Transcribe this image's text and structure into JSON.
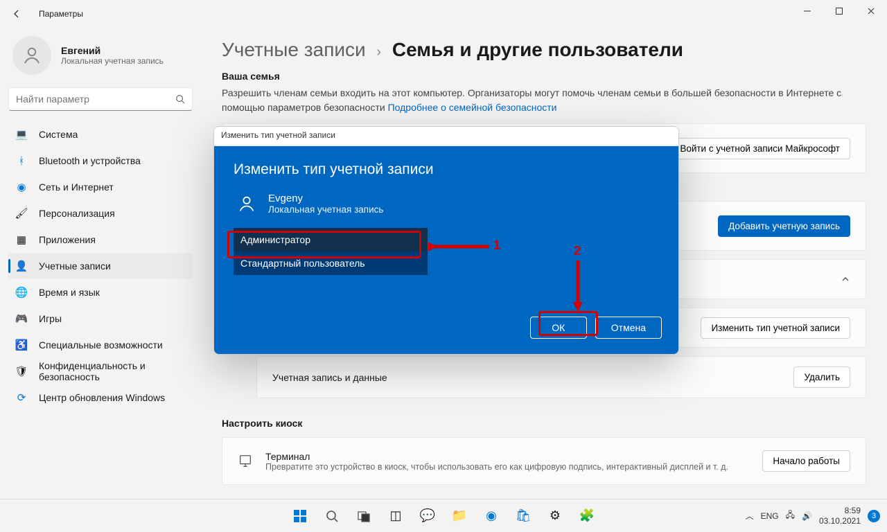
{
  "window": {
    "title": "Параметры"
  },
  "user": {
    "name": "Евгений",
    "sub": "Локальная учетная запись"
  },
  "search": {
    "placeholder": "Найти параметр"
  },
  "nav": {
    "items": [
      {
        "label": "Система"
      },
      {
        "label": "Bluetooth и устройства"
      },
      {
        "label": "Сеть и Интернет"
      },
      {
        "label": "Персонализация"
      },
      {
        "label": "Приложения"
      },
      {
        "label": "Учетные записи"
      },
      {
        "label": "Время и язык"
      },
      {
        "label": "Игры"
      },
      {
        "label": "Специальные возможности"
      },
      {
        "label": "Конфиденциальность и безопасность"
      },
      {
        "label": "Центр обновления Windows"
      }
    ]
  },
  "breadcrumb": {
    "parent": "Учетные записи",
    "current": "Семья и другие пользователи"
  },
  "family": {
    "heading": "Ваша семья",
    "desc": "Разрешить членам семьи входить на этот компьютер. Организаторы могут помочь членам семьи в большей безопасности в Интернете с помощью параметров безопасности  ",
    "link": "Подробнее о семейной безопасности",
    "signin_btn": "Войти с учетной записи Майкрософт"
  },
  "other": {
    "add_btn": "Добавить учетную запись",
    "change_type_btn": "Изменить тип учетной записи",
    "acct_data_label": "Учетная запись и данные",
    "delete_btn": "Удалить"
  },
  "kiosk": {
    "heading": "Настроить киоск",
    "title": "Терминал",
    "desc": "Превратите это устройство в киоск, чтобы использовать его как цифровую подпись, интерактивный дисплей и т. д.",
    "start_btn": "Начало работы"
  },
  "dialog": {
    "window_title": "Изменить тип учетной записи",
    "title": "Изменить тип учетной записи",
    "user_name": "Evgeny",
    "user_sub": "Локальная учетная запись",
    "options": [
      "Администратор",
      "Стандартный пользователь"
    ],
    "ok": "ОК",
    "cancel": "Отмена"
  },
  "annotations": {
    "label1": "1",
    "label2": "2"
  },
  "taskbar": {
    "lang": "ENG",
    "time": "8:59",
    "date": "03.10.2021",
    "badge": "3"
  }
}
